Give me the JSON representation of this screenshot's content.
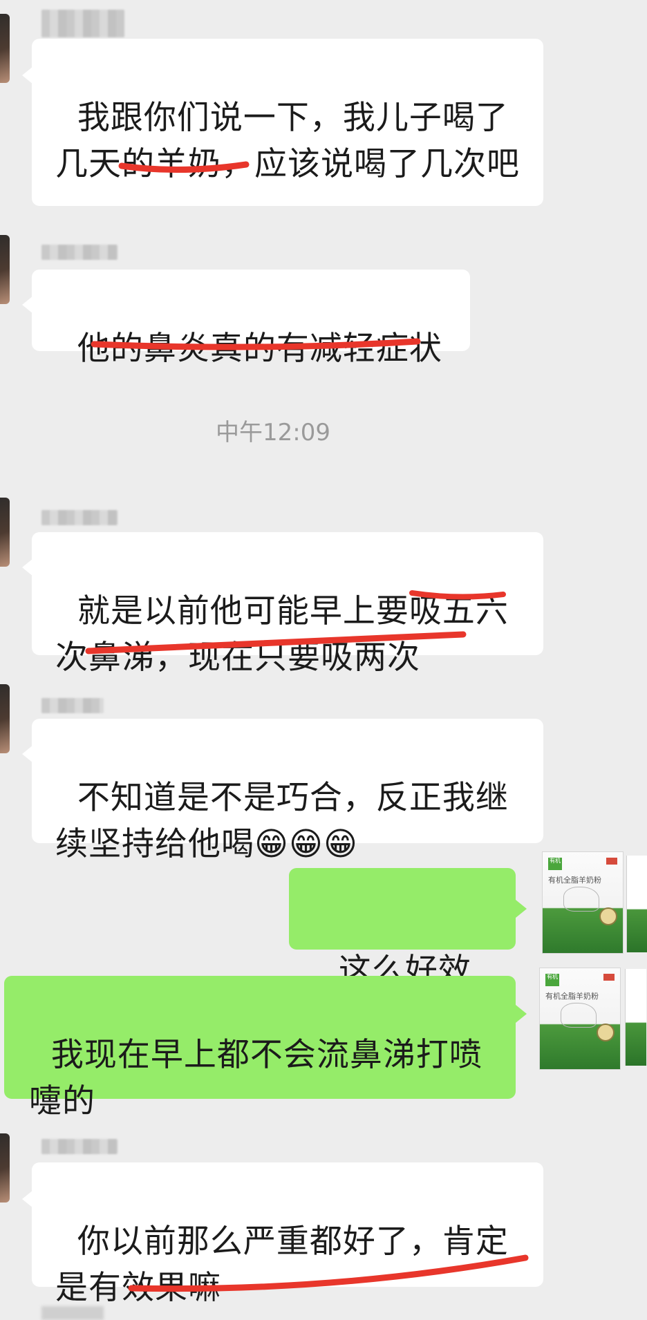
{
  "chat": {
    "timestamp": "中午12:09",
    "messages": [
      {
        "side": "left",
        "text": "我跟你们说一下，我儿子喝了几天的羊奶，应该说喝了几次吧"
      },
      {
        "side": "left",
        "text": "他的鼻炎真的有减轻症状"
      },
      {
        "side": "left",
        "text": "就是以前他可能早上要吸五六次鼻涕，现在只要吸两次"
      },
      {
        "side": "left",
        "text": "不知道是不是巧合，反正我继续坚持给他喝😁😁😁"
      },
      {
        "side": "right",
        "text": "这么好效果"
      },
      {
        "side": "right",
        "text": "我现在早上都不会流鼻涕打喷嚏的"
      },
      {
        "side": "left",
        "text": "你以前那么严重都好了，肯定是有效果嘛"
      }
    ],
    "product_avatar": {
      "title": "有机全脂羊奶粉",
      "brand_badge": "有机"
    },
    "annotation_color": "#e8362b",
    "bubble_colors": {
      "incoming": "#ffffff",
      "outgoing": "#95ec69",
      "background": "#ededed"
    }
  }
}
